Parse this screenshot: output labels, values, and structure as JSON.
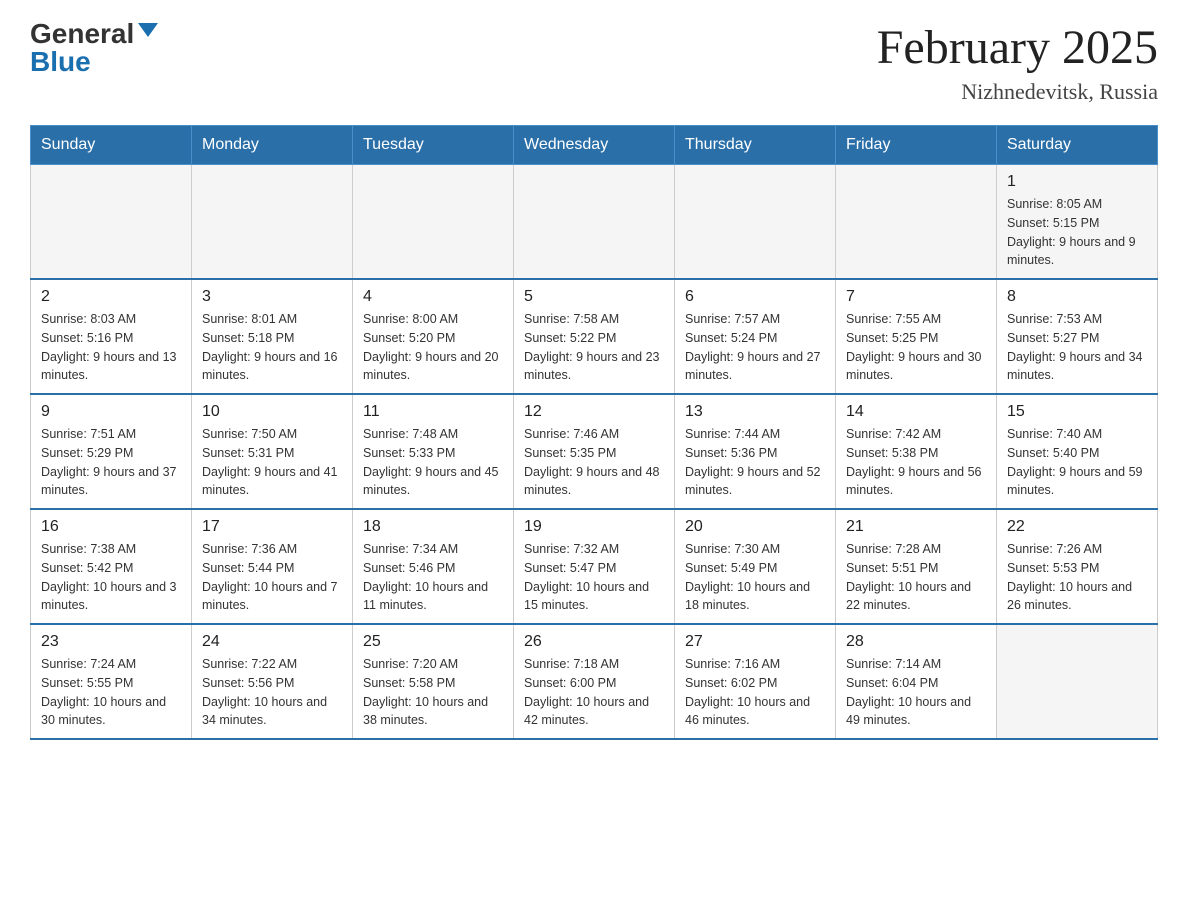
{
  "header": {
    "logo_general": "General",
    "logo_blue": "Blue",
    "month_title": "February 2025",
    "location": "Nizhnedevitsk, Russia"
  },
  "weekdays": [
    "Sunday",
    "Monday",
    "Tuesday",
    "Wednesday",
    "Thursday",
    "Friday",
    "Saturday"
  ],
  "weeks": [
    [
      {
        "day": "",
        "info": ""
      },
      {
        "day": "",
        "info": ""
      },
      {
        "day": "",
        "info": ""
      },
      {
        "day": "",
        "info": ""
      },
      {
        "day": "",
        "info": ""
      },
      {
        "day": "",
        "info": ""
      },
      {
        "day": "1",
        "info": "Sunrise: 8:05 AM\nSunset: 5:15 PM\nDaylight: 9 hours and 9 minutes."
      }
    ],
    [
      {
        "day": "2",
        "info": "Sunrise: 8:03 AM\nSunset: 5:16 PM\nDaylight: 9 hours and 13 minutes."
      },
      {
        "day": "3",
        "info": "Sunrise: 8:01 AM\nSunset: 5:18 PM\nDaylight: 9 hours and 16 minutes."
      },
      {
        "day": "4",
        "info": "Sunrise: 8:00 AM\nSunset: 5:20 PM\nDaylight: 9 hours and 20 minutes."
      },
      {
        "day": "5",
        "info": "Sunrise: 7:58 AM\nSunset: 5:22 PM\nDaylight: 9 hours and 23 minutes."
      },
      {
        "day": "6",
        "info": "Sunrise: 7:57 AM\nSunset: 5:24 PM\nDaylight: 9 hours and 27 minutes."
      },
      {
        "day": "7",
        "info": "Sunrise: 7:55 AM\nSunset: 5:25 PM\nDaylight: 9 hours and 30 minutes."
      },
      {
        "day": "8",
        "info": "Sunrise: 7:53 AM\nSunset: 5:27 PM\nDaylight: 9 hours and 34 minutes."
      }
    ],
    [
      {
        "day": "9",
        "info": "Sunrise: 7:51 AM\nSunset: 5:29 PM\nDaylight: 9 hours and 37 minutes."
      },
      {
        "day": "10",
        "info": "Sunrise: 7:50 AM\nSunset: 5:31 PM\nDaylight: 9 hours and 41 minutes."
      },
      {
        "day": "11",
        "info": "Sunrise: 7:48 AM\nSunset: 5:33 PM\nDaylight: 9 hours and 45 minutes."
      },
      {
        "day": "12",
        "info": "Sunrise: 7:46 AM\nSunset: 5:35 PM\nDaylight: 9 hours and 48 minutes."
      },
      {
        "day": "13",
        "info": "Sunrise: 7:44 AM\nSunset: 5:36 PM\nDaylight: 9 hours and 52 minutes."
      },
      {
        "day": "14",
        "info": "Sunrise: 7:42 AM\nSunset: 5:38 PM\nDaylight: 9 hours and 56 minutes."
      },
      {
        "day": "15",
        "info": "Sunrise: 7:40 AM\nSunset: 5:40 PM\nDaylight: 9 hours and 59 minutes."
      }
    ],
    [
      {
        "day": "16",
        "info": "Sunrise: 7:38 AM\nSunset: 5:42 PM\nDaylight: 10 hours and 3 minutes."
      },
      {
        "day": "17",
        "info": "Sunrise: 7:36 AM\nSunset: 5:44 PM\nDaylight: 10 hours and 7 minutes."
      },
      {
        "day": "18",
        "info": "Sunrise: 7:34 AM\nSunset: 5:46 PM\nDaylight: 10 hours and 11 minutes."
      },
      {
        "day": "19",
        "info": "Sunrise: 7:32 AM\nSunset: 5:47 PM\nDaylight: 10 hours and 15 minutes."
      },
      {
        "day": "20",
        "info": "Sunrise: 7:30 AM\nSunset: 5:49 PM\nDaylight: 10 hours and 18 minutes."
      },
      {
        "day": "21",
        "info": "Sunrise: 7:28 AM\nSunset: 5:51 PM\nDaylight: 10 hours and 22 minutes."
      },
      {
        "day": "22",
        "info": "Sunrise: 7:26 AM\nSunset: 5:53 PM\nDaylight: 10 hours and 26 minutes."
      }
    ],
    [
      {
        "day": "23",
        "info": "Sunrise: 7:24 AM\nSunset: 5:55 PM\nDaylight: 10 hours and 30 minutes."
      },
      {
        "day": "24",
        "info": "Sunrise: 7:22 AM\nSunset: 5:56 PM\nDaylight: 10 hours and 34 minutes."
      },
      {
        "day": "25",
        "info": "Sunrise: 7:20 AM\nSunset: 5:58 PM\nDaylight: 10 hours and 38 minutes."
      },
      {
        "day": "26",
        "info": "Sunrise: 7:18 AM\nSunset: 6:00 PM\nDaylight: 10 hours and 42 minutes."
      },
      {
        "day": "27",
        "info": "Sunrise: 7:16 AM\nSunset: 6:02 PM\nDaylight: 10 hours and 46 minutes."
      },
      {
        "day": "28",
        "info": "Sunrise: 7:14 AM\nSunset: 6:04 PM\nDaylight: 10 hours and 49 minutes."
      },
      {
        "day": "",
        "info": ""
      }
    ]
  ]
}
